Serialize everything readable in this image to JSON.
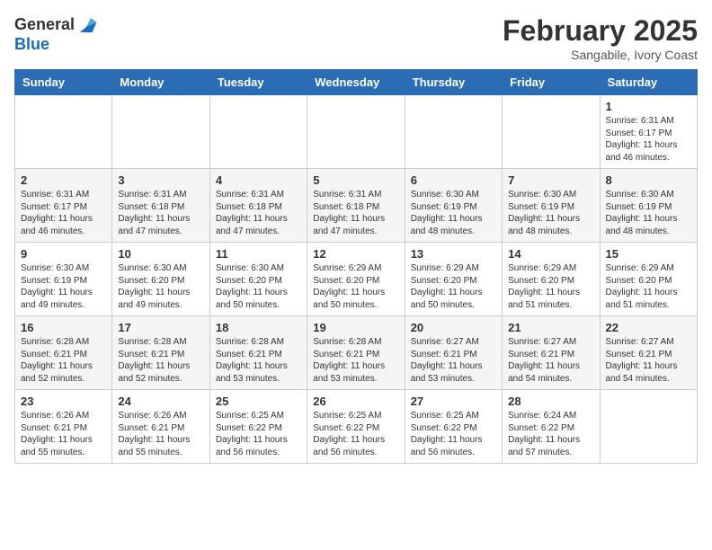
{
  "logo": {
    "general": "General",
    "blue": "Blue"
  },
  "header": {
    "month": "February 2025",
    "location": "Sangabile, Ivory Coast"
  },
  "weekdays": [
    "Sunday",
    "Monday",
    "Tuesday",
    "Wednesday",
    "Thursday",
    "Friday",
    "Saturday"
  ],
  "weeks": [
    [
      {
        "day": "",
        "info": ""
      },
      {
        "day": "",
        "info": ""
      },
      {
        "day": "",
        "info": ""
      },
      {
        "day": "",
        "info": ""
      },
      {
        "day": "",
        "info": ""
      },
      {
        "day": "",
        "info": ""
      },
      {
        "day": "1",
        "info": "Sunrise: 6:31 AM\nSunset: 6:17 PM\nDaylight: 11 hours and 46 minutes."
      }
    ],
    [
      {
        "day": "2",
        "info": "Sunrise: 6:31 AM\nSunset: 6:17 PM\nDaylight: 11 hours and 46 minutes."
      },
      {
        "day": "3",
        "info": "Sunrise: 6:31 AM\nSunset: 6:18 PM\nDaylight: 11 hours and 47 minutes."
      },
      {
        "day": "4",
        "info": "Sunrise: 6:31 AM\nSunset: 6:18 PM\nDaylight: 11 hours and 47 minutes."
      },
      {
        "day": "5",
        "info": "Sunrise: 6:31 AM\nSunset: 6:18 PM\nDaylight: 11 hours and 47 minutes."
      },
      {
        "day": "6",
        "info": "Sunrise: 6:30 AM\nSunset: 6:19 PM\nDaylight: 11 hours and 48 minutes."
      },
      {
        "day": "7",
        "info": "Sunrise: 6:30 AM\nSunset: 6:19 PM\nDaylight: 11 hours and 48 minutes."
      },
      {
        "day": "8",
        "info": "Sunrise: 6:30 AM\nSunset: 6:19 PM\nDaylight: 11 hours and 48 minutes."
      }
    ],
    [
      {
        "day": "9",
        "info": "Sunrise: 6:30 AM\nSunset: 6:19 PM\nDaylight: 11 hours and 49 minutes."
      },
      {
        "day": "10",
        "info": "Sunrise: 6:30 AM\nSunset: 6:20 PM\nDaylight: 11 hours and 49 minutes."
      },
      {
        "day": "11",
        "info": "Sunrise: 6:30 AM\nSunset: 6:20 PM\nDaylight: 11 hours and 50 minutes."
      },
      {
        "day": "12",
        "info": "Sunrise: 6:29 AM\nSunset: 6:20 PM\nDaylight: 11 hours and 50 minutes."
      },
      {
        "day": "13",
        "info": "Sunrise: 6:29 AM\nSunset: 6:20 PM\nDaylight: 11 hours and 50 minutes."
      },
      {
        "day": "14",
        "info": "Sunrise: 6:29 AM\nSunset: 6:20 PM\nDaylight: 11 hours and 51 minutes."
      },
      {
        "day": "15",
        "info": "Sunrise: 6:29 AM\nSunset: 6:20 PM\nDaylight: 11 hours and 51 minutes."
      }
    ],
    [
      {
        "day": "16",
        "info": "Sunrise: 6:28 AM\nSunset: 6:21 PM\nDaylight: 11 hours and 52 minutes."
      },
      {
        "day": "17",
        "info": "Sunrise: 6:28 AM\nSunset: 6:21 PM\nDaylight: 11 hours and 52 minutes."
      },
      {
        "day": "18",
        "info": "Sunrise: 6:28 AM\nSunset: 6:21 PM\nDaylight: 11 hours and 53 minutes."
      },
      {
        "day": "19",
        "info": "Sunrise: 6:28 AM\nSunset: 6:21 PM\nDaylight: 11 hours and 53 minutes."
      },
      {
        "day": "20",
        "info": "Sunrise: 6:27 AM\nSunset: 6:21 PM\nDaylight: 11 hours and 53 minutes."
      },
      {
        "day": "21",
        "info": "Sunrise: 6:27 AM\nSunset: 6:21 PM\nDaylight: 11 hours and 54 minutes."
      },
      {
        "day": "22",
        "info": "Sunrise: 6:27 AM\nSunset: 6:21 PM\nDaylight: 11 hours and 54 minutes."
      }
    ],
    [
      {
        "day": "23",
        "info": "Sunrise: 6:26 AM\nSunset: 6:21 PM\nDaylight: 11 hours and 55 minutes."
      },
      {
        "day": "24",
        "info": "Sunrise: 6:26 AM\nSunset: 6:21 PM\nDaylight: 11 hours and 55 minutes."
      },
      {
        "day": "25",
        "info": "Sunrise: 6:25 AM\nSunset: 6:22 PM\nDaylight: 11 hours and 56 minutes."
      },
      {
        "day": "26",
        "info": "Sunrise: 6:25 AM\nSunset: 6:22 PM\nDaylight: 11 hours and 56 minutes."
      },
      {
        "day": "27",
        "info": "Sunrise: 6:25 AM\nSunset: 6:22 PM\nDaylight: 11 hours and 56 minutes."
      },
      {
        "day": "28",
        "info": "Sunrise: 6:24 AM\nSunset: 6:22 PM\nDaylight: 11 hours and 57 minutes."
      },
      {
        "day": "",
        "info": ""
      }
    ]
  ]
}
